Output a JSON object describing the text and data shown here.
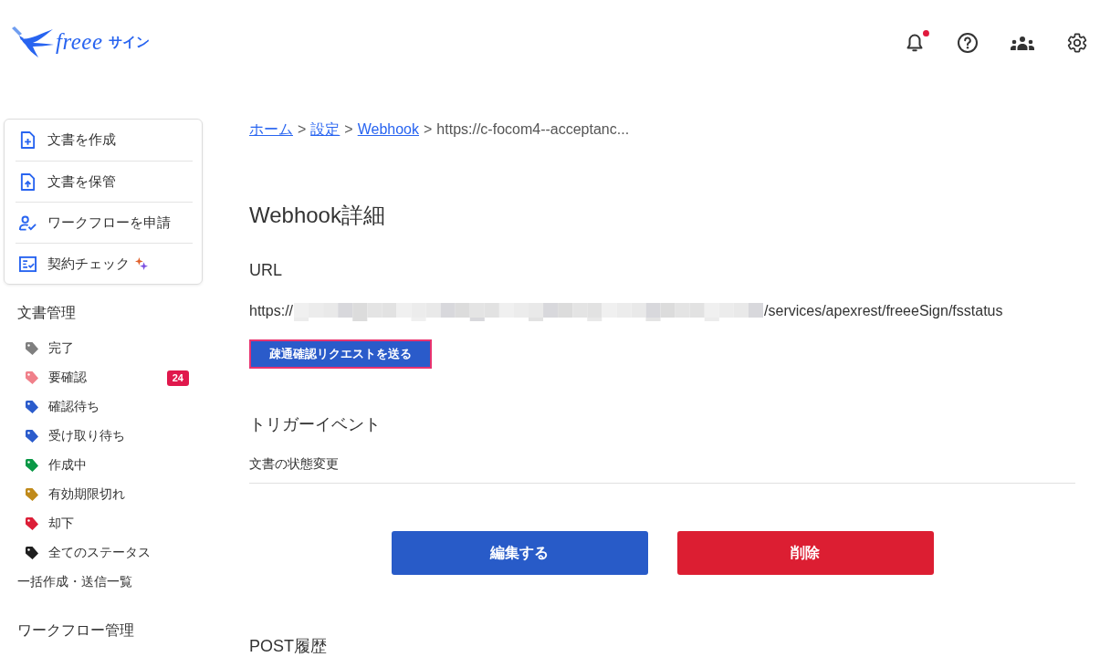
{
  "header": {
    "logo": {
      "wordmark": "freee",
      "product": "サイン"
    },
    "notifications": {
      "unread": true
    }
  },
  "quick_actions": [
    {
      "kind": "create",
      "label": "文書を作成",
      "ai": false
    },
    {
      "kind": "store",
      "label": "文書を保管",
      "ai": false
    },
    {
      "kind": "workflow",
      "label": "ワークフローを申請",
      "ai": false
    },
    {
      "kind": "check",
      "label": "契約チェック",
      "ai": true
    }
  ],
  "sidebar": {
    "document_section": {
      "title": "文書管理",
      "statuses": [
        {
          "label": "完了",
          "color": "#7f7f7f"
        },
        {
          "label": "要確認",
          "color": "#f0808a",
          "badge": "24"
        },
        {
          "label": "確認待ち",
          "color": "#2b5ccc"
        },
        {
          "label": "受け取り待ち",
          "color": "#2b5ccc"
        },
        {
          "label": "作成中",
          "color": "#0a9846"
        },
        {
          "label": "有効期限切れ",
          "color": "#c08a1a"
        },
        {
          "label": "却下",
          "color": "#dc1e37"
        },
        {
          "label": "全てのステータス",
          "color": "#1e1e1e"
        }
      ],
      "bulk_link": "一括作成・送信一覧"
    },
    "workflow_section": {
      "title": "ワークフロー管理"
    }
  },
  "breadcrumb": [
    {
      "label": "ホーム",
      "link": true
    },
    {
      "separator": ">",
      "label": "設定",
      "link": true
    },
    {
      "separator": ">",
      "label": "Webhook",
      "link": true
    },
    {
      "separator": ">",
      "label": "https://c-focom4--acceptanc...",
      "link": false
    }
  ],
  "page_title": "Webhook詳細",
  "url_section": {
    "label": "URL",
    "value_start": "https://",
    "redacted": true,
    "value_end": "/services/apexrest/freeeSign/fsstatus",
    "test_button": {
      "label": "疎通確認リクエストを送る",
      "focused": true
    }
  },
  "trigger_section": {
    "label": "トリガーイベント",
    "value": "文書の状態変更"
  },
  "actions": [
    {
      "kind": "primary",
      "label": "編集する"
    },
    {
      "kind": "danger",
      "label": "削除"
    }
  ],
  "post_history": {
    "label": "POST履歴"
  }
}
